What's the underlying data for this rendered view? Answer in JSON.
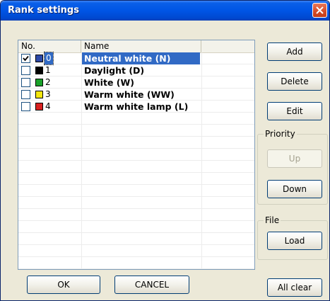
{
  "window": {
    "title": "Rank settings"
  },
  "list": {
    "columns": [
      "No.",
      "Name",
      ""
    ],
    "rows": [
      {
        "checked": true,
        "color": "#2d4aa8",
        "number": "0",
        "name": "Neutral white (N)",
        "selected": true
      },
      {
        "checked": false,
        "color": "#000000",
        "number": "1",
        "name": "Daylight (D)",
        "selected": false
      },
      {
        "checked": false,
        "color": "#1aa12a",
        "number": "2",
        "name": "White (W)",
        "selected": false
      },
      {
        "checked": false,
        "color": "#f3e60d",
        "number": "3",
        "name": "Warm white (WW)",
        "selected": false
      },
      {
        "checked": false,
        "color": "#d82020",
        "number": "4",
        "name": "Warm white lamp (L)",
        "selected": false
      }
    ]
  },
  "buttons": {
    "add": "Add",
    "delete": "Delete",
    "edit": "Edit",
    "up": "Up",
    "down": "Down",
    "load": "Load",
    "ok": "OK",
    "cancel": "CANCEL",
    "all_clear": "All clear"
  },
  "groups": {
    "priority": "Priority",
    "file": "File"
  },
  "icons": {
    "close": "close-icon",
    "check": "checkmark-icon"
  }
}
